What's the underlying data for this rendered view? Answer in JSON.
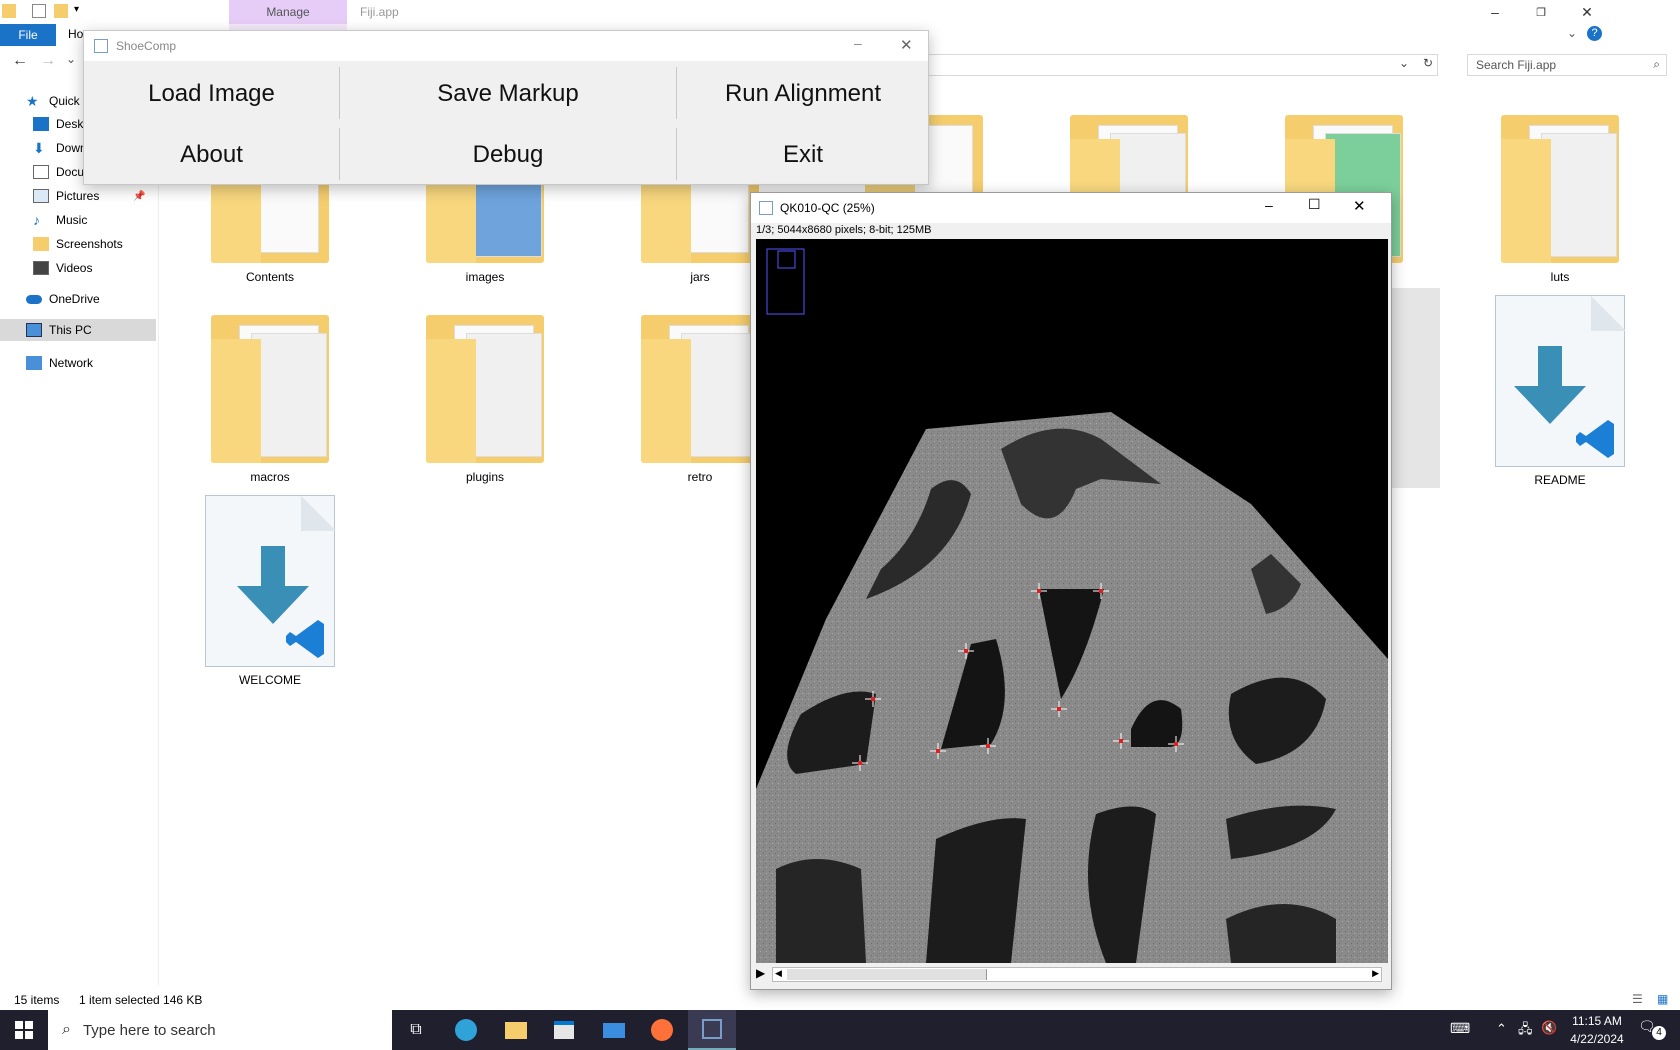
{
  "explorer": {
    "window_title": "Fiji.app",
    "ribbon": {
      "file_tab": "File",
      "home_tab": "Ho",
      "manage_tab": "Manage"
    },
    "search_placeholder": "Search Fiji.app",
    "nav": [
      {
        "label": "Quick a",
        "icon": "star-icon"
      },
      {
        "label": "Deskto",
        "icon": "desktop-icon"
      },
      {
        "label": "Down",
        "icon": "download-icon"
      },
      {
        "label": "Documents",
        "icon": "document-icon"
      },
      {
        "label": "Pictures",
        "icon": "pictures-icon"
      },
      {
        "label": "Music",
        "icon": "music-icon"
      },
      {
        "label": "Screenshots",
        "icon": "folder-icon"
      },
      {
        "label": "Videos",
        "icon": "video-icon"
      },
      {
        "label": "OneDrive",
        "icon": "cloud-icon"
      },
      {
        "label": "This PC",
        "icon": "computer-icon"
      },
      {
        "label": "Network",
        "icon": "network-icon"
      }
    ],
    "files": [
      {
        "name": "Contents",
        "type": "folder"
      },
      {
        "name": "images",
        "type": "folder"
      },
      {
        "name": "jars",
        "type": "folder"
      },
      {
        "name": "luts",
        "type": "folder"
      },
      {
        "name": "macros",
        "type": "folder"
      },
      {
        "name": "plugins",
        "type": "folder"
      },
      {
        "name": "retro",
        "type": "folder"
      },
      {
        "name": "README",
        "type": "file"
      },
      {
        "name": "WELCOME",
        "type": "file"
      }
    ],
    "status": {
      "count": "15 items",
      "selection": "1 item selected  146 KB"
    }
  },
  "shoecomp": {
    "title": "ShoeComp",
    "buttons": {
      "load": "Load Image",
      "save": "Save Markup",
      "run": "Run Alignment",
      "about": "About",
      "debug": "Debug",
      "exit": "Exit"
    }
  },
  "imagej": {
    "title": "QK010-QC (25%)",
    "info": "1/3; 5044x8680 pixels; 8-bit; 125MB"
  },
  "taskbar": {
    "search_placeholder": "Type here to search",
    "time": "11:15 AM",
    "date": "4/22/2024",
    "notifications": "4"
  },
  "colors": {
    "accent": "#1a73c7",
    "manage_tab": "#e6cdf7",
    "taskbar": "#1f1f2e",
    "marker": "#e02020"
  }
}
